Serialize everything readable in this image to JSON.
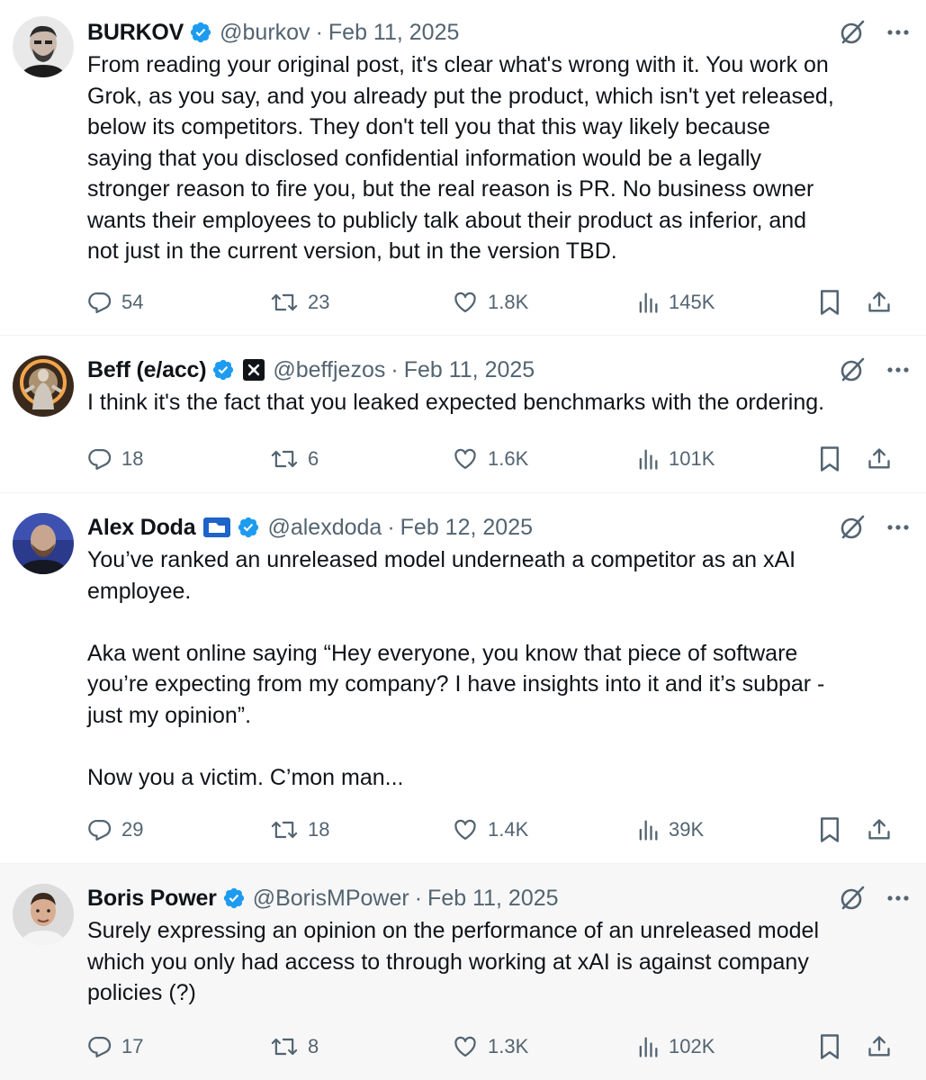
{
  "tweets": [
    {
      "name": "BURKOV",
      "handle": "@burkov",
      "separator": "·",
      "date": "Feb 11, 2025",
      "text": "From reading your original post, it's clear what's wrong with it. You work on\nGrok, as you say, and you already put the product, which isn't yet released,\nbelow its competitors. They don't tell you that this way likely because\nsaying that you disclosed confidential information would be a legally\nstronger reason to fire you, but the real reason is PR. No business owner\nwants their employees to publicly talk about their product as inferior, and\nnot just in the current version, but in the version TBD.",
      "replies": "54",
      "retweets": "23",
      "likes": "1.8K",
      "views": "145K"
    },
    {
      "name": "Beff (e/acc)",
      "handle": "@beffjezos",
      "separator": "·",
      "date": "Feb 11, 2025",
      "text": "I think it's the fact that you leaked expected benchmarks with the ordering.",
      "replies": "18",
      "retweets": "6",
      "likes": "1.6K",
      "views": "101K"
    },
    {
      "name": "Alex Doda",
      "handle": "@alexdoda",
      "separator": "·",
      "date": "Feb 12, 2025",
      "text": "You’ve ranked an unreleased model underneath a competitor as an xAI\nemployee.\n\nAka went online saying “Hey everyone, you know that piece of software\nyou’re expecting from my company? I have insights into it and it’s subpar -\njust my opinion”.\n\nNow you a victim. C’mon man...",
      "replies": "29",
      "retweets": "18",
      "likes": "1.4K",
      "views": "39K"
    },
    {
      "name": "Boris Power",
      "handle": "@BorisMPower",
      "separator": "·",
      "date": "Feb 11, 2025",
      "text": "Surely expressing an opinion on the performance of an unreleased model\nwhich you only had access to through working at xAI is against company\npolicies (?)",
      "replies": "17",
      "retweets": "8",
      "likes": "1.3K",
      "views": "102K"
    }
  ],
  "icons": [
    "verified-badge-icon",
    "grok-icon",
    "more-icon",
    "reply-icon",
    "retweet-icon",
    "like-icon",
    "views-icon",
    "bookmark-icon",
    "share-icon"
  ],
  "colors": {
    "verified": "#1d9bf0",
    "secondary_text": "#536471",
    "primary_text": "#0f1419",
    "hover_bg": "#f7f7f7"
  }
}
